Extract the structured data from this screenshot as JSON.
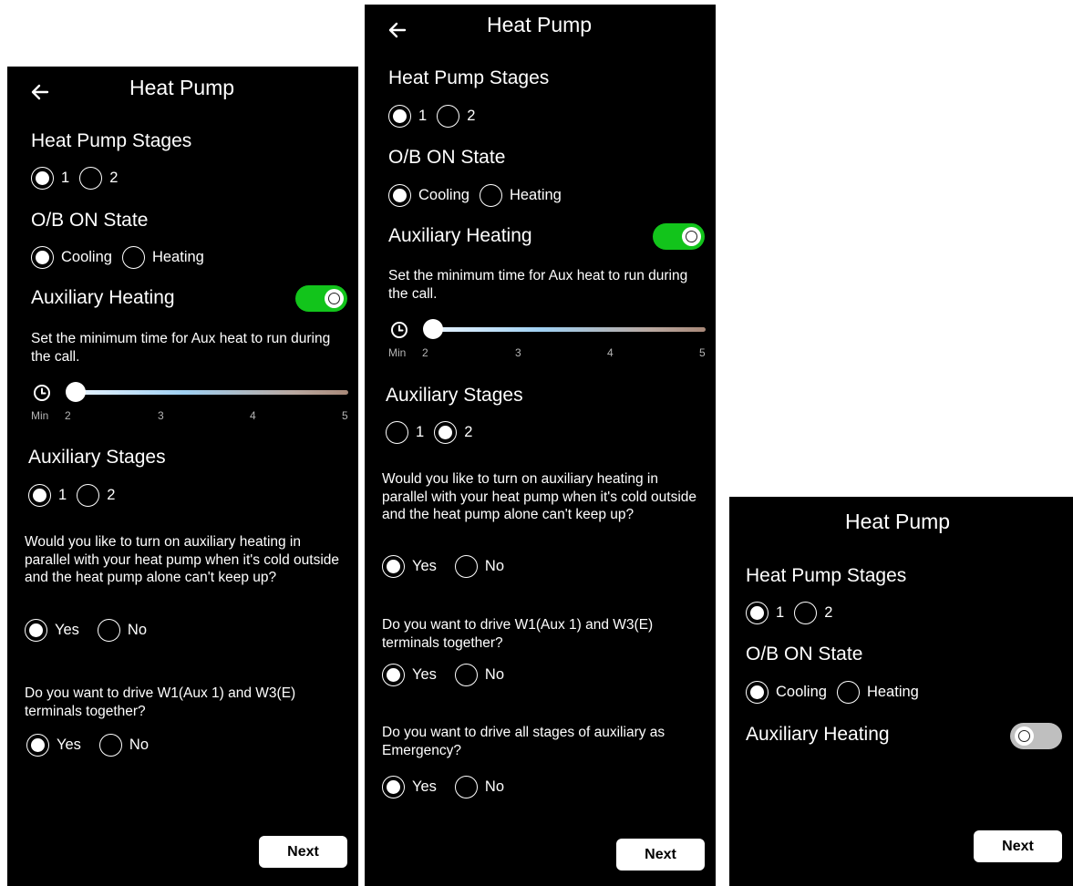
{
  "colors": {
    "background": "#000000",
    "toggle_on": "#12c41b",
    "toggle_off": "#bfbfbf",
    "text": "#ffffff"
  },
  "icons": [
    "back-arrow-icon",
    "clock-icon"
  ],
  "screens": [
    {
      "title": "Heat Pump",
      "heat_pump_stages": {
        "label": "Heat Pump Stages",
        "options": [
          "1",
          "2"
        ],
        "selected": "1"
      },
      "ob_on_state": {
        "label": "O/B ON State",
        "options": [
          "Cooling",
          "Heating"
        ],
        "selected": "Cooling"
      },
      "auxiliary_heating": {
        "label": "Auxiliary Heating",
        "enabled": true
      },
      "min_time": {
        "description": "Set the minimum time for Aux heat to run during the call.",
        "unit_label": "Min",
        "ticks": [
          "2",
          "3",
          "4",
          "5"
        ],
        "value": 2
      },
      "auxiliary_stages": {
        "label": "Auxiliary Stages",
        "options": [
          "1",
          "2"
        ],
        "selected": "1"
      },
      "parallel_question": {
        "text": "Would you like to turn on auxiliary heating in parallel with your heat pump when it's cold outside and the heat pump alone can't keep up?",
        "options": [
          "Yes",
          "No"
        ],
        "selected": "Yes"
      },
      "drive_w1_w3_question": {
        "text": "Do you want to drive W1(Aux 1) and W3(E) terminals together?",
        "options": [
          "Yes",
          "No"
        ],
        "selected": "Yes"
      },
      "next_label": "Next"
    },
    {
      "title": "Heat Pump",
      "heat_pump_stages": {
        "label": "Heat Pump Stages",
        "options": [
          "1",
          "2"
        ],
        "selected": "1"
      },
      "ob_on_state": {
        "label": "O/B ON State",
        "options": [
          "Cooling",
          "Heating"
        ],
        "selected": "Cooling"
      },
      "auxiliary_heating": {
        "label": "Auxiliary Heating",
        "enabled": true
      },
      "min_time": {
        "description": "Set the minimum time for Aux heat to run during the call.",
        "unit_label": "Min",
        "ticks": [
          "2",
          "3",
          "4",
          "5"
        ],
        "value": 2
      },
      "auxiliary_stages": {
        "label": "Auxiliary Stages",
        "options": [
          "1",
          "2"
        ],
        "selected": "2"
      },
      "parallel_question": {
        "text": "Would you like to turn on auxiliary heating in parallel with your heat pump when it's cold outside and the heat pump alone can't keep up?",
        "options": [
          "Yes",
          "No"
        ],
        "selected": "Yes"
      },
      "drive_w1_w3_question": {
        "text": "Do you want to drive W1(Aux 1) and W3(E) terminals together?",
        "options": [
          "Yes",
          "No"
        ],
        "selected": "Yes"
      },
      "emergency_question": {
        "text": "Do you want to drive all stages of auxiliary as Emergency?",
        "options": [
          "Yes",
          "No"
        ],
        "selected": "Yes"
      },
      "next_label": "Next"
    },
    {
      "title": "Heat Pump",
      "heat_pump_stages": {
        "label": "Heat Pump Stages",
        "options": [
          "1",
          "2"
        ],
        "selected": "1"
      },
      "ob_on_state": {
        "label": "O/B ON State",
        "options": [
          "Cooling",
          "Heating"
        ],
        "selected": "Cooling"
      },
      "auxiliary_heating": {
        "label": "Auxiliary Heating",
        "enabled": false
      },
      "next_label": "Next"
    }
  ]
}
